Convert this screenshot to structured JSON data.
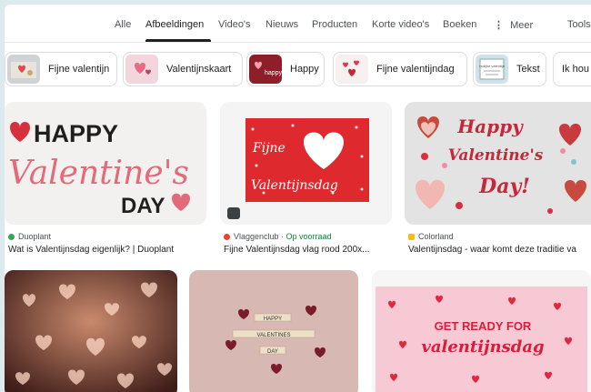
{
  "tabs": {
    "all": "Alle",
    "images": "Afbeeldingen",
    "videos": "Video's",
    "news": "Nieuws",
    "products": "Producten",
    "short_videos": "Korte video's",
    "books": "Boeken",
    "more": "Meer",
    "tools": "Tools"
  },
  "chips": [
    {
      "label": "Fijne valentijn"
    },
    {
      "label": "Valentijnskaart"
    },
    {
      "label": "Happy"
    },
    {
      "label": "Fijne valentijndag"
    },
    {
      "label": "Tekst"
    },
    {
      "label": "Ik hou"
    }
  ],
  "chip_thumbs": {
    "happy_text": "happy",
    "tekst_text": "vrolijke valentijn"
  },
  "results": [
    {
      "source": "Duoplant",
      "title": "Wat is Valentijnsdag eigenlijk? | Duoplant",
      "art": {
        "line1": "HAPPY",
        "line2": "Valentine's",
        "line3": "DAY"
      }
    },
    {
      "source": "Vlaggenclub",
      "stock": "Op voorraad",
      "title": "Fijne Valentijnsdag vlag rood 200x...",
      "art": {
        "line1": "Fijne",
        "line2": "Valentijnsdag"
      }
    },
    {
      "source": "Colorland",
      "title": "Valentijnsdag - waar komt deze traditie va",
      "art": {
        "line1": "Happy",
        "line2": "Valentine's",
        "line3": "Day!"
      }
    },
    {
      "art": {}
    },
    {
      "art": {
        "line1": "HAPPY",
        "line2": "VALENTINES",
        "line3": "DAY"
      }
    },
    {
      "art": {
        "line1": "GET READY FOR",
        "line2": "valentijnsdag"
      }
    }
  ],
  "colors": {
    "accent_red": "#d6303c",
    "pink_text": "#e36a7a",
    "favicon_duoplant": "#34a853",
    "favicon_vlaggen": "#ea4335"
  }
}
